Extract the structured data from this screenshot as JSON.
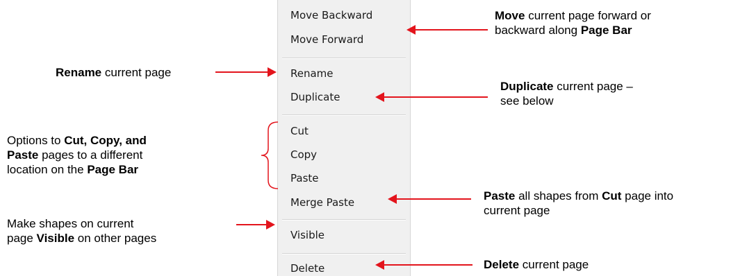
{
  "menu": {
    "items": [
      {
        "label": "Move Backward"
      },
      {
        "label": "Move Forward"
      },
      {
        "label": "Rename"
      },
      {
        "label": "Duplicate"
      },
      {
        "label": "Cut"
      },
      {
        "label": "Copy"
      },
      {
        "label": "Paste"
      },
      {
        "label": "Merge Paste"
      },
      {
        "label": "Visible"
      },
      {
        "label": "Delete"
      }
    ]
  },
  "annotations": {
    "move": {
      "b1": "Move",
      "t1": " current page forward or",
      "t2": "backward along ",
      "b2": "Page Bar"
    },
    "rename": {
      "b1": "Rename",
      "t1": " current page"
    },
    "duplicate": {
      "b1": "Duplicate",
      "t1": " current page –",
      "t2": "see below"
    },
    "cut_copy_paste": {
      "t1": "Options to ",
      "b1": "Cut, Copy, and",
      "b2": "Paste",
      "t2": " pages to a different",
      "t3": "location on the ",
      "b3": "Page Bar"
    },
    "merge_paste": {
      "b1": "Paste",
      "t1": " all shapes from ",
      "b2": "Cut",
      "t2": " page into",
      "t3": "current page"
    },
    "visible": {
      "t1": "Make shapes on current",
      "t2": "page ",
      "b1": "Visible",
      "t3": " on other pages"
    },
    "delete": {
      "b1": "Delete",
      "t1": " current page"
    }
  },
  "colors": {
    "arrow": "#e3141c",
    "menu_bg": "#f0f0f0"
  }
}
